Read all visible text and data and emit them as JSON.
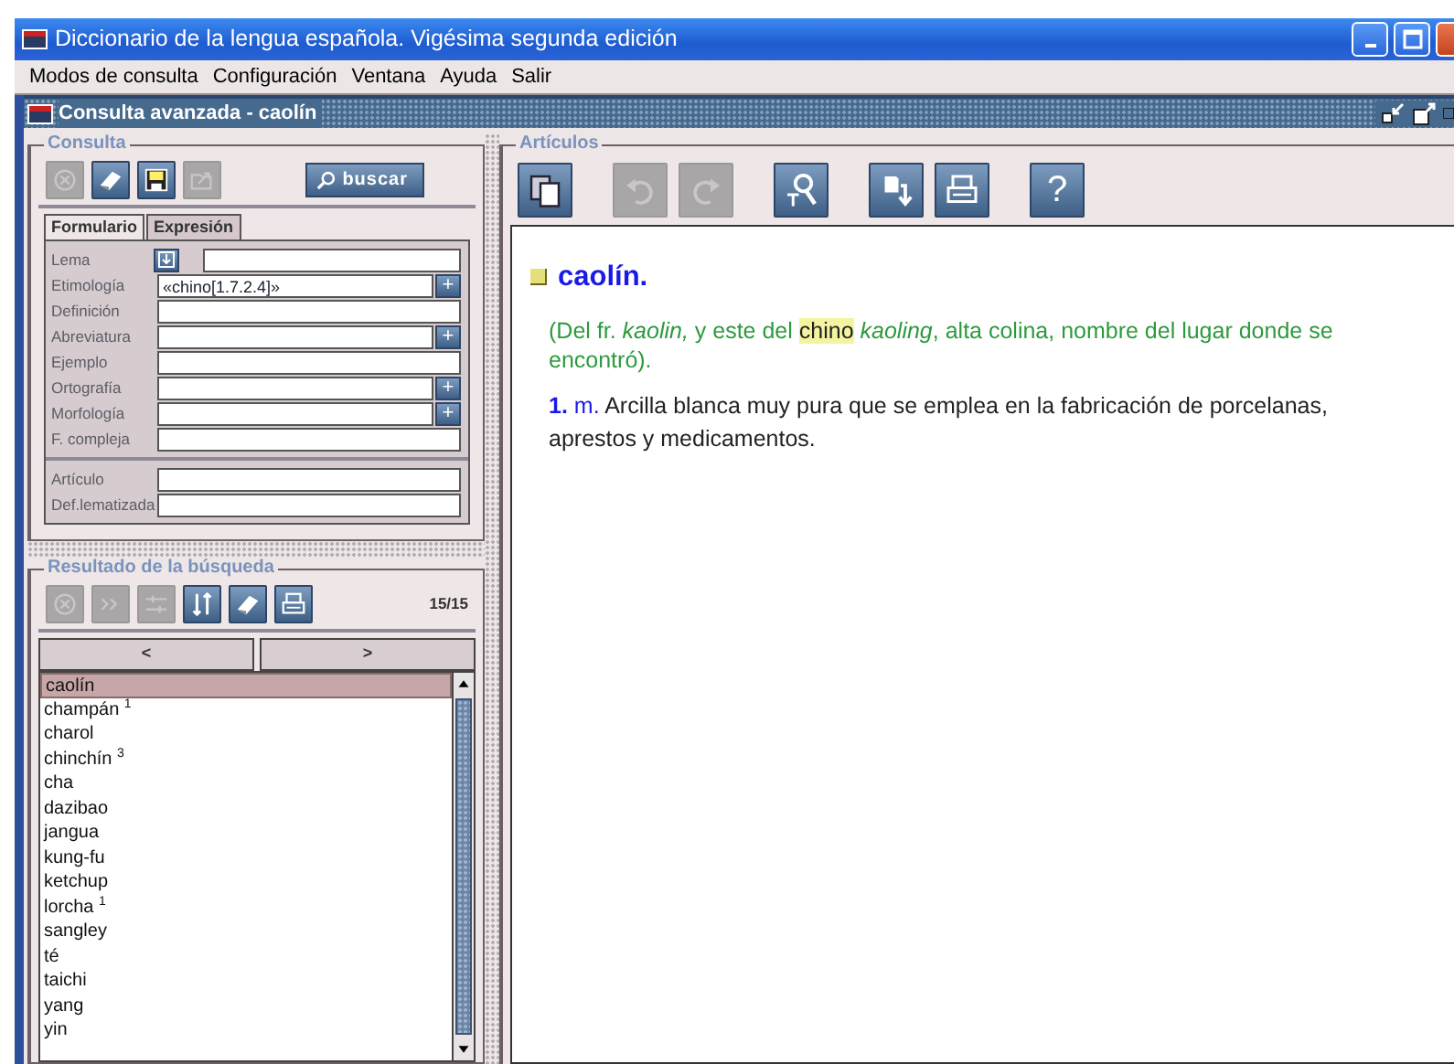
{
  "window": {
    "title": "Diccionario de la lengua española. Vigésima segunda edición"
  },
  "menu": [
    {
      "label": "Modos de consulta"
    },
    {
      "label": "Configuración"
    },
    {
      "label": "Ventana"
    },
    {
      "label": "Ayuda"
    },
    {
      "label": "Salir"
    }
  ],
  "frame": {
    "title": "Consulta avanzada - caolín"
  },
  "consulta": {
    "legend": "Consulta",
    "tools": [
      {
        "disabled": true
      },
      {
        "disabled": false
      },
      {
        "disabled": false
      },
      {
        "disabled": true
      }
    ],
    "search_button": "buscar",
    "tabs": [
      {
        "label": "Formulario",
        "selected": true
      },
      {
        "label": "Expresión",
        "selected": false
      }
    ],
    "fields": [
      {
        "label": "Lema",
        "kind": "lema"
      },
      {
        "label": "Etimología",
        "kind": "picker",
        "value": "«chino[1.7.2.4]»",
        "button": "+"
      },
      {
        "label": "Definición",
        "kind": "plain"
      },
      {
        "label": "Abreviatura",
        "kind": "picker",
        "button": "+"
      },
      {
        "label": "Ejemplo",
        "kind": "plain"
      },
      {
        "label": "Ortografía",
        "kind": "picker",
        "button": "+"
      },
      {
        "label": "Morfología",
        "kind": "picker",
        "button": "+"
      },
      {
        "label": "F. compleja",
        "kind": "plain"
      }
    ],
    "extra_fields": [
      {
        "label": "Artículo",
        "kind": "plain"
      },
      {
        "label": "Def.lematizada",
        "kind": "plain"
      }
    ]
  },
  "resultado": {
    "legend": "Resultado de la búsqueda",
    "tools": [
      {
        "disabled": true
      },
      {
        "disabled": true
      },
      {
        "disabled": true
      },
      {
        "disabled": false
      },
      {
        "disabled": false
      },
      {
        "disabled": false
      }
    ],
    "count": "15/15",
    "nav": [
      "<",
      ">"
    ],
    "items": [
      {
        "label": "caolín",
        "selected": true
      },
      {
        "label": "champán $^{1}$",
        "selected": false
      },
      {
        "label": "charol",
        "selected": false
      },
      {
        "label": "chinchín $^{3}$",
        "selected": false
      },
      {
        "label": "cha",
        "selected": false
      },
      {
        "label": "dazibao",
        "selected": false
      },
      {
        "label": "jangua",
        "selected": false
      },
      {
        "label": "kung-fu",
        "selected": false
      },
      {
        "label": "ketchup",
        "selected": false
      },
      {
        "label": "lorcha $^{1}$",
        "selected": false
      },
      {
        "label": "sangley",
        "selected": false
      },
      {
        "label": "té",
        "selected": false
      },
      {
        "label": "taichi",
        "selected": false
      },
      {
        "label": "yang",
        "selected": false
      },
      {
        "label": "yin",
        "selected": false
      }
    ]
  },
  "articulos": {
    "legend": "Artículos",
    "tools": [
      {
        "disabled": false
      },
      {
        "disabled": true
      },
      {
        "disabled": true
      },
      {
        "disabled": false
      },
      {
        "disabled": false
      },
      {
        "disabled": false
      },
      {
        "disabled": false,
        "label": "?"
      }
    ],
    "entry": {
      "headword": "caolín.",
      "etymology": {
        "before": "(Del fr. *kaolin,* y este del",
        "highlight": "chino",
        "after": "*kaoling*, alta colina, nombre del lugar donde se encontró)."
      },
      "senses": [
        {
          "number": "1.",
          "abbr": "m.",
          "text": "Arcilla blanca muy pura que se emplea en la fabricación de porcelanas, aprestos y medicamentos."
        }
      ]
    }
  }
}
